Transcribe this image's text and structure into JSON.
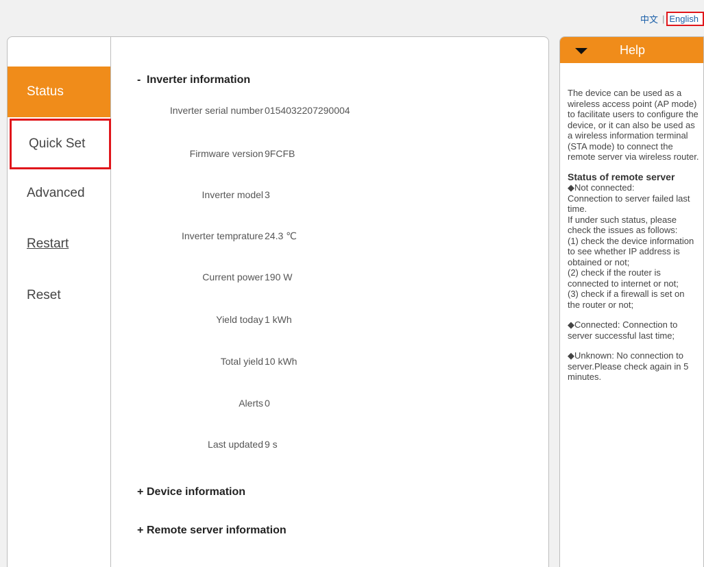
{
  "lang": {
    "zh": "中文",
    "separator": "|",
    "en": "English"
  },
  "nav": {
    "status": "Status",
    "quick_set": "Quick Set",
    "advanced": "Advanced",
    "restart": "Restart",
    "reset": "Reset"
  },
  "sections": {
    "inverter": {
      "sign": "-",
      "title": "Inverter information"
    },
    "device": {
      "sign": "+",
      "title": "Device information"
    },
    "remote": {
      "sign": "+",
      "title": "Remote server information"
    }
  },
  "inverter_rows": [
    {
      "label": "Inverter serial number",
      "value": "0154032207290004"
    },
    {
      "label": "Firmware version",
      "value": "9FCFB"
    },
    {
      "label": "Inverter model",
      "value": "3"
    },
    {
      "label": "Inverter temprature",
      "value": "24.3 ℃"
    },
    {
      "label": "Current power",
      "value": "190 W"
    },
    {
      "label": "Yield today",
      "value": "1 kWh"
    },
    {
      "label": "Total yield",
      "value": "10 kWh"
    },
    {
      "label": "Alerts",
      "value": "0"
    },
    {
      "label": "Last updated",
      "value": "9 s"
    }
  ],
  "help": {
    "title": "Help",
    "intro": "The device can be used as a wireless access point (AP mode) to facilitate users to configure the device, or it can also be used as a wireless information terminal (STA mode) to connect the remote server via wireless router.",
    "status_title": "Status of remote server",
    "not_connected_head": "◆Not connected:",
    "not_connected_text": "Connection to server failed last time.",
    "if_under": "If under such status, please check the issues as follows:",
    "check1": "(1) check the device information to see whether IP address is obtained or not;",
    "check2": "(2) check if the router is connected to internet or not;",
    "check3": "(3) check if a firewall is set on the router or not;",
    "connected": "◆Connected: Connection to server successful last time;",
    "unknown": "◆Unknown: No connection to server.Please check again in 5 minutes."
  },
  "colors": {
    "accent": "#f08c1a",
    "highlight_border": "#e0161b",
    "link": "#1a5fa8"
  }
}
